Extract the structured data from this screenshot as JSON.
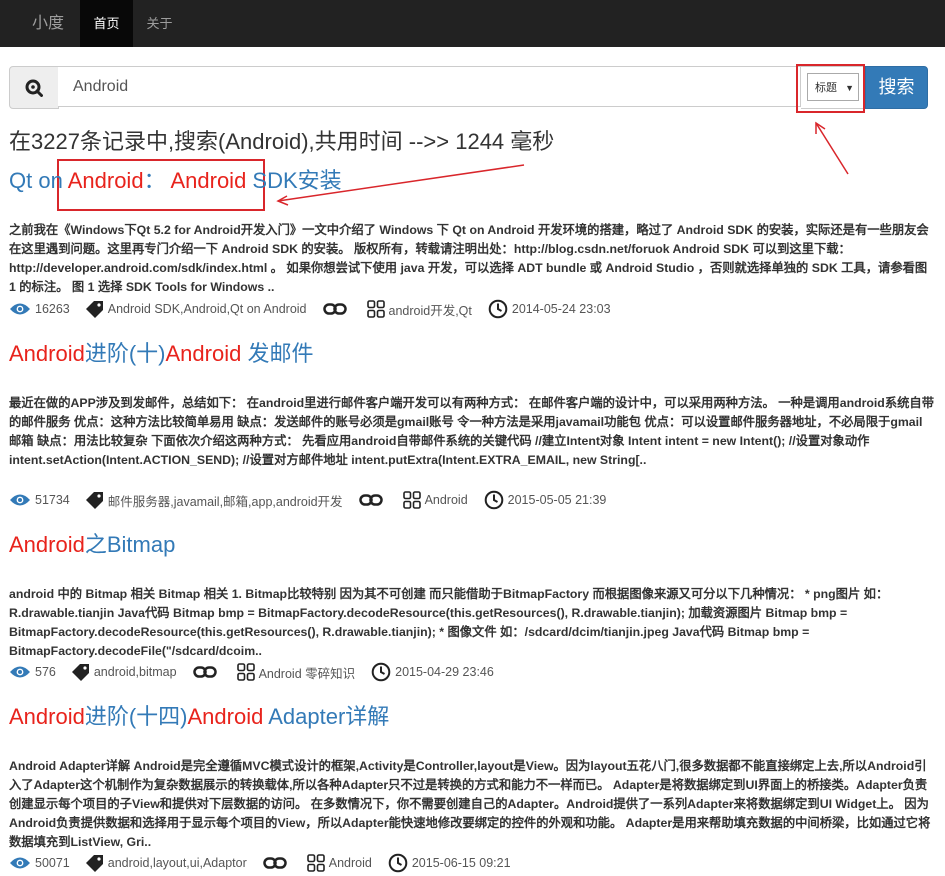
{
  "navbar": {
    "brand": "小度",
    "items": [
      {
        "label": "首页",
        "active": true
      },
      {
        "label": "关于",
        "active": false
      }
    ]
  },
  "search": {
    "icon": "search-icon",
    "value": "Android",
    "field_select": "标题",
    "button_label": "搜索"
  },
  "summary": "在3227条记录中,搜索(Android),共用时间 -->> 1244 毫秒",
  "accent_color": "#337ab7",
  "highlight_color": "#e8231c",
  "results": [
    {
      "title_parts": [
        {
          "text": "Qt on ",
          "hl": false
        },
        {
          "text": "Android",
          "hl": true
        },
        {
          "text": "： ",
          "hl": false
        },
        {
          "text": "Android",
          "hl": true
        },
        {
          "text": " SDK安装",
          "hl": false
        }
      ],
      "desc": "      之前我在《Windows下Qt 5.2 for Android开发入门》一文中介绍了 Windows 下 Qt on Android 开发环境的搭建，略过了 Android SDK 的安装，实际还是有一些朋友会在这里遇到问题。这里再专门介绍一下 Android SDK 的安装。      版权所有，转载请注明出处：http://blog.csdn.net/foruok      Android SDK 可以到这里下载：http://developer.android.com/sdk/index.html 。      如果你想尝试下使用 java 开发，可以选择 ADT bundle 或 Android Studio ，否则就选择单独的 SDK 工具，请参看图 1 的标注。                图 1 选择 SDK Tools for Windows ..",
      "views": "16263",
      "tags": "Android SDK,Android,Qt on Android",
      "category": "android开发,Qt",
      "date": "2014-05-24 23:03"
    },
    {
      "title_parts": [
        {
          "text": "Android",
          "hl": true
        },
        {
          "text": "进阶(十)",
          "hl": false
        },
        {
          "text": "Android",
          "hl": true
        },
        {
          "text": " 发邮件",
          "hl": false
        }
      ],
      "desc": "最近在做的APP涉及到发邮件，总结如下：    在android里进行邮件客户端开发可以有两种方式：    在邮件客户端的设计中，可以采用两种方法。    一种是调用android系统自带的邮件服务    优点：这种方法比较简单易用    缺点：发送邮件的账号必须是gmail账号    令一种方法是采用javamail功能包    优点：可以设置邮件服务器地址，不必局限于gmail邮箱    缺点：用法比较复杂    下面依次介绍这两种方式：    先看应用android自带邮件系统的关键代码    //建立Intent对象  Intent intent = new Intent();    //设置对象动作    intent.setAction(Intent.ACTION_SEND);    //设置对方邮件地址  intent.putExtra(Intent.EXTRA_EMAIL, new String[..",
      "views": "51734",
      "tags": "邮件服务器,javamail,邮箱,app,android开发",
      "category": "Android",
      "date": "2015-05-05 21:39"
    },
    {
      "title_parts": [
        {
          "text": "Android",
          "hl": true
        },
        {
          "text": "之Bitmap",
          "hl": false
        }
      ],
      "desc": "android 中的 Bitmap 相关 Bitmap 相关 1. Bitmap比较特别 因为其不可创建 而只能借助于BitmapFactory 而根据图像来源又可分以下几种情况：  * png图片 如：R.drawable.tianjin Java代码  Bitmap bmp = BitmapFactory.decodeResource(this.getResources(), R.drawable.tianjin);  加载资源图片 Bitmap bmp = BitmapFactory.decodeResource(this.getResources(), R.drawable.tianjin); * 图像文件 如：/sdcard/dcim/tianjin.jpeg Java代码  Bitmap bmp = BitmapFactory.decodeFile(\"/sdcard/dcoim..",
      "views": "576",
      "tags": "android,bitmap",
      "category": "Android 零碎知识",
      "date": "2015-04-29 23:46"
    },
    {
      "title_parts": [
        {
          "text": "Android",
          "hl": true
        },
        {
          "text": "进阶(十四)",
          "hl": false
        },
        {
          "text": "Android",
          "hl": true
        },
        {
          "text": " Adapter详解",
          "hl": false
        }
      ],
      "desc": "Android Adapter详解 Android是完全遵循MVC模式设计的框架,Activity是Controller,layout是View。因为layout五花八门,很多数据都不能直接绑定上去,所以Android引入了Adapter这个机制作为复杂数据展示的转换载体,所以各种Adapter只不过是转换的方式和能力不一样而已。  Adapter是将数据绑定到UI界面上的桥接类。Adapter负责创建显示每个项目的子View和提供对下层数据的访问。   在多数情况下，你不需要创建自己的Adapter。Android提供了一系列Adapter来将数据绑定到UI Widget上。   因为Android负责提供数据和选择用于显示每个项目的View，所以Adapter能快速地修改要绑定的控件的外观和功能。  Adapter是用来帮助填充数据的中间桥梁，比如通过它将数据填充到ListView, Gri..",
      "views": "50071",
      "tags": "android,layout,ui,Adaptor",
      "category": "Android",
      "date": "2015-06-15 09:21"
    }
  ]
}
